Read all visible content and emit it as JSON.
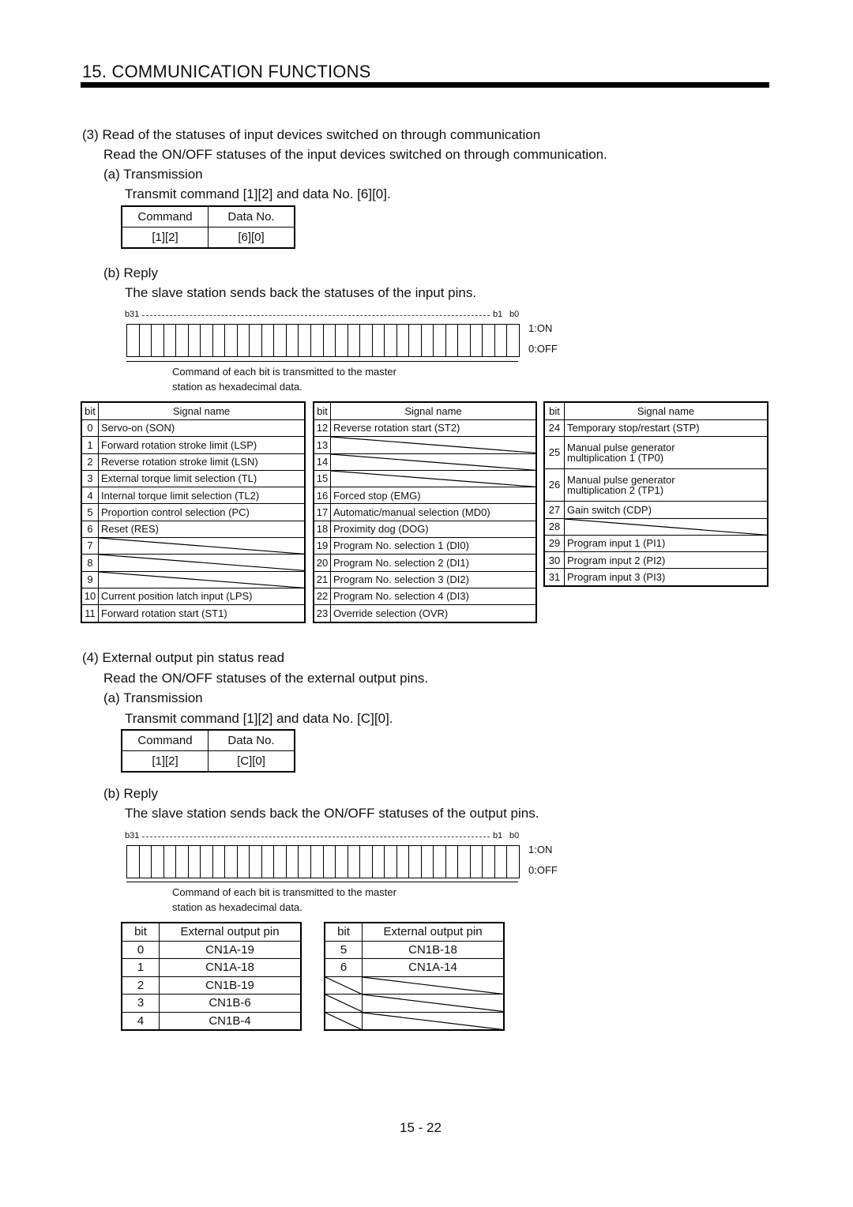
{
  "header": {
    "title": "15. COMMUNICATION FUNCTIONS"
  },
  "section3": {
    "heading": "(3) Read of the statuses of input devices switched on through communication",
    "description": "Read the ON/OFF statuses of the input devices switched on through communication.",
    "transmission": {
      "label": "(a) Transmission",
      "text": "Transmit command [1][2] and data No. [6][0].",
      "table": {
        "headers": [
          "Command",
          "Data No."
        ],
        "values": [
          "[1][2]",
          "[6][0]"
        ]
      }
    },
    "reply": {
      "label": "(b) Reply",
      "text": "The slave station sends back the statuses of the input pins.",
      "register": {
        "msb_label": "b31",
        "b1_label": "b1",
        "b0_label": "b0",
        "on_label": "1:ON",
        "off_label": "0:OFF",
        "note_line1": "Command of each bit is transmitted to the master",
        "note_line2": "station as hexadecimal data."
      }
    },
    "signal_tables": [
      {
        "headers": [
          "bit",
          "Signal name"
        ],
        "rows": [
          {
            "bit": "0",
            "name": "Servo-on (SON)"
          },
          {
            "bit": "1",
            "name": "Forward rotation stroke limit (LSP)"
          },
          {
            "bit": "2",
            "name": "Reverse rotation stroke limit (LSN)"
          },
          {
            "bit": "3",
            "name": "External torque limit selection (TL)"
          },
          {
            "bit": "4",
            "name": "Internal torque limit selection (TL2)"
          },
          {
            "bit": "5",
            "name": "Proportion control selection (PC)"
          },
          {
            "bit": "6",
            "name": "Reset (RES)"
          },
          {
            "bit": "7",
            "name": ""
          },
          {
            "bit": "8",
            "name": ""
          },
          {
            "bit": "9",
            "name": ""
          },
          {
            "bit": "10",
            "name": "Current position latch input (LPS)"
          },
          {
            "bit": "11",
            "name": "Forward rotation start (ST1)"
          }
        ]
      },
      {
        "headers": [
          "bit",
          "Signal name"
        ],
        "rows": [
          {
            "bit": "12",
            "name": "Reverse rotation start (ST2)"
          },
          {
            "bit": "13",
            "name": ""
          },
          {
            "bit": "14",
            "name": ""
          },
          {
            "bit": "15",
            "name": ""
          },
          {
            "bit": "16",
            "name": "Forced stop (EMG)"
          },
          {
            "bit": "17",
            "name": "Automatic/manual selection (MD0)"
          },
          {
            "bit": "18",
            "name": "Proximity dog (DOG)"
          },
          {
            "bit": "19",
            "name": "Program No. selection 1 (DI0)"
          },
          {
            "bit": "20",
            "name": "Program No. selection 2 (DI1)"
          },
          {
            "bit": "21",
            "name": "Program No. selection 3 (DI2)"
          },
          {
            "bit": "22",
            "name": "Program No. selection 4 (DI3)"
          },
          {
            "bit": "23",
            "name": "Override selection (OVR)"
          }
        ]
      },
      {
        "headers": [
          "bit",
          "Signal name"
        ],
        "rows": [
          {
            "bit": "24",
            "name": "Temporary stop/restart (STP)"
          },
          {
            "bit": "25",
            "name": "Manual pulse generator",
            "name2": "multiplication 1 (TP0)"
          },
          {
            "bit": "26",
            "name": "Manual pulse generator",
            "name2": "multiplication 2 (TP1)"
          },
          {
            "bit": "27",
            "name": "Gain switch (CDP)"
          },
          {
            "bit": "28",
            "name": ""
          },
          {
            "bit": "29",
            "name": "Program input 1  (PI1)"
          },
          {
            "bit": "30",
            "name": "Program input 2  (PI2)"
          },
          {
            "bit": "31",
            "name": "Program input 3  (PI3)"
          }
        ]
      }
    ]
  },
  "section4": {
    "heading": "(4) External output pin status read",
    "description": "Read the ON/OFF statuses of the external output pins.",
    "transmission": {
      "label": "(a) Transmission",
      "text": "Transmit command [1][2] and data No. [C][0].",
      "table": {
        "headers": [
          "Command",
          "Data No."
        ],
        "values": [
          "[1][2]",
          "[C][0]"
        ]
      }
    },
    "reply": {
      "label": "(b) Reply",
      "text": "The slave station sends back the ON/OFF statuses of the output pins.",
      "register": {
        "msb_label": "b31",
        "b1_label": "b1",
        "b0_label": "b0",
        "on_label": "1:ON",
        "off_label": "0:OFF",
        "note_line1": "Command of each bit is transmitted to the master",
        "note_line2": "station as hexadecimal data."
      }
    },
    "output_tables": [
      {
        "headers": [
          "bit",
          "External output pin"
        ],
        "rows": [
          {
            "bit": "0",
            "pin": "CN1A-19"
          },
          {
            "bit": "1",
            "pin": "CN1A-18"
          },
          {
            "bit": "2",
            "pin": "CN1B-19"
          },
          {
            "bit": "3",
            "pin": "CN1B-6"
          },
          {
            "bit": "4",
            "pin": "CN1B-4"
          }
        ]
      },
      {
        "headers": [
          "bit",
          "External output pin"
        ],
        "rows": [
          {
            "bit": "5",
            "pin": "CN1B-18"
          },
          {
            "bit": "6",
            "pin": "CN1A-14"
          },
          {
            "bit": "",
            "pin": ""
          },
          {
            "bit": "",
            "pin": ""
          },
          {
            "bit": "",
            "pin": ""
          }
        ]
      }
    ]
  },
  "footer": {
    "page_number": "15 -  22"
  }
}
